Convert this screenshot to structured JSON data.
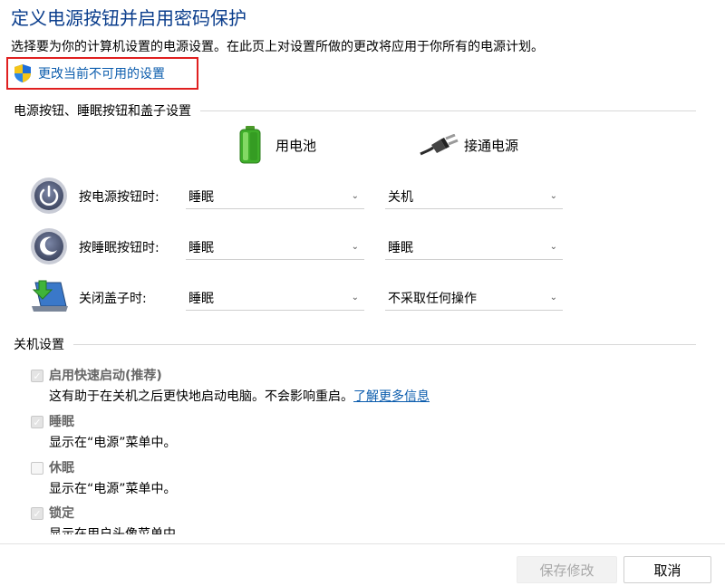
{
  "header": {
    "title": "定义电源按钮并启用密码保护",
    "description": "选择要为你的计算机设置的电源设置。在此页上对设置所做的更改将应用于你所有的电源计划。",
    "change_link": "更改当前不可用的设置"
  },
  "power_section": {
    "title": "电源按钮、睡眠按钮和盖子设置",
    "column_battery": "用电池",
    "column_plugged": "接通电源",
    "rows": [
      {
        "label": "按电源按钮时:",
        "battery": "睡眠",
        "plugged": "关机",
        "icon": "power-button-icon"
      },
      {
        "label": "按睡眠按钮时:",
        "battery": "睡眠",
        "plugged": "睡眠",
        "icon": "sleep-button-icon"
      },
      {
        "label": "关闭盖子时:",
        "battery": "睡眠",
        "plugged": "不采取任何操作",
        "icon": "laptop-lid-icon"
      }
    ]
  },
  "shutdown_section": {
    "title": "关机设置",
    "items": [
      {
        "label": "启用快速启动(推荐)",
        "checked": true,
        "desc": "这有助于在关机之后更快地启动电脑。不会影响重启。",
        "link": "了解更多信息"
      },
      {
        "label": "睡眠",
        "checked": true,
        "desc": "显示在“电源”菜单中。"
      },
      {
        "label": "休眠",
        "checked": false,
        "desc": "显示在“电源”菜单中。"
      },
      {
        "label": "锁定",
        "checked": true,
        "desc": "显示在用户头像菜单中。"
      }
    ]
  },
  "footer": {
    "save_label": "保存修改",
    "cancel_label": "取消"
  },
  "colors": {
    "title": "#0a3d8c",
    "link": "#0b5cad",
    "highlight_border": "#e02020"
  }
}
